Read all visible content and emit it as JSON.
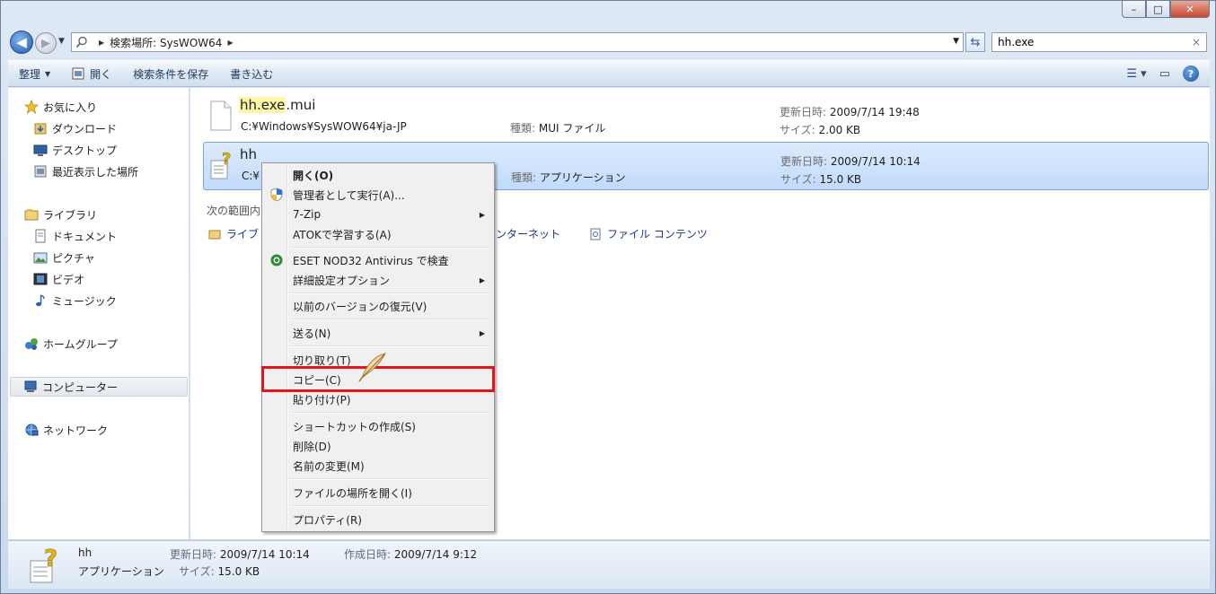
{
  "window": {
    "caption": {
      "minimize": "–",
      "maximize": "□",
      "close": "✕"
    }
  },
  "address": {
    "path_label": "検索場所: SysWOW64"
  },
  "search": {
    "value": "hh.exe",
    "clear": "×"
  },
  "toolbar": {
    "organize": "整理",
    "open": "開く",
    "save_search": "検索条件を保存",
    "burn": "書き込む"
  },
  "nav": {
    "favorites": "お気に入り",
    "downloads": "ダウンロード",
    "desktop": "デスクトップ",
    "recent": "最近表示した場所",
    "libraries": "ライブラリ",
    "documents": "ドキュメント",
    "pictures": "ピクチャ",
    "videos": "ビデオ",
    "music": "ミュージック",
    "homegroup": "ホームグループ",
    "computer": "コンピューター",
    "network": "ネットワーク"
  },
  "results": [
    {
      "name_highlight": "hh.exe",
      "name_rest": ".mui",
      "path": "C:¥Windows¥SysWOW64¥ja-JP",
      "type_label": "種類:",
      "type": "MUI ファイル",
      "modified_label": "更新日時:",
      "modified": "2009/7/14 19:48",
      "size_label": "サイズ:",
      "size": "2.00 KB"
    },
    {
      "name": "hh",
      "path": "C:¥",
      "type_label": "種類:",
      "type": "アプリケーション",
      "modified_label": "更新日時:",
      "modified": "2009/7/14 10:14",
      "size_label": "サイズ:",
      "size": "15.0 KB"
    }
  ],
  "search_again": {
    "label": "次の範囲内",
    "libraries": "ライブ",
    "internet": "インターネット",
    "contents": "ファイル コンテンツ"
  },
  "context_menu": {
    "open": "開く(O)",
    "run_as_admin": "管理者として実行(A)...",
    "sevenzip": "7-Zip",
    "atok": "ATOKで学習する(A)",
    "eset": "ESET NOD32 Antivirus で検査",
    "advanced": "詳細設定オプション",
    "restore": "以前のバージョンの復元(V)",
    "send_to": "送る(N)",
    "cut": "切り取り(T)",
    "copy": "コピー(C)",
    "paste": "貼り付け(P)",
    "shortcut": "ショートカットの作成(S)",
    "delete": "削除(D)",
    "rename": "名前の変更(M)",
    "open_location": "ファイルの場所を開く(I)",
    "properties": "プロパティ(R)"
  },
  "details": {
    "name": "hh",
    "type": "アプリケーション",
    "modified_label": "更新日時:",
    "modified": "2009/7/14 10:14",
    "size_label": "サイズ:",
    "size": "15.0 KB",
    "created_label": "作成日時:",
    "created": "2009/7/14 9:12"
  }
}
